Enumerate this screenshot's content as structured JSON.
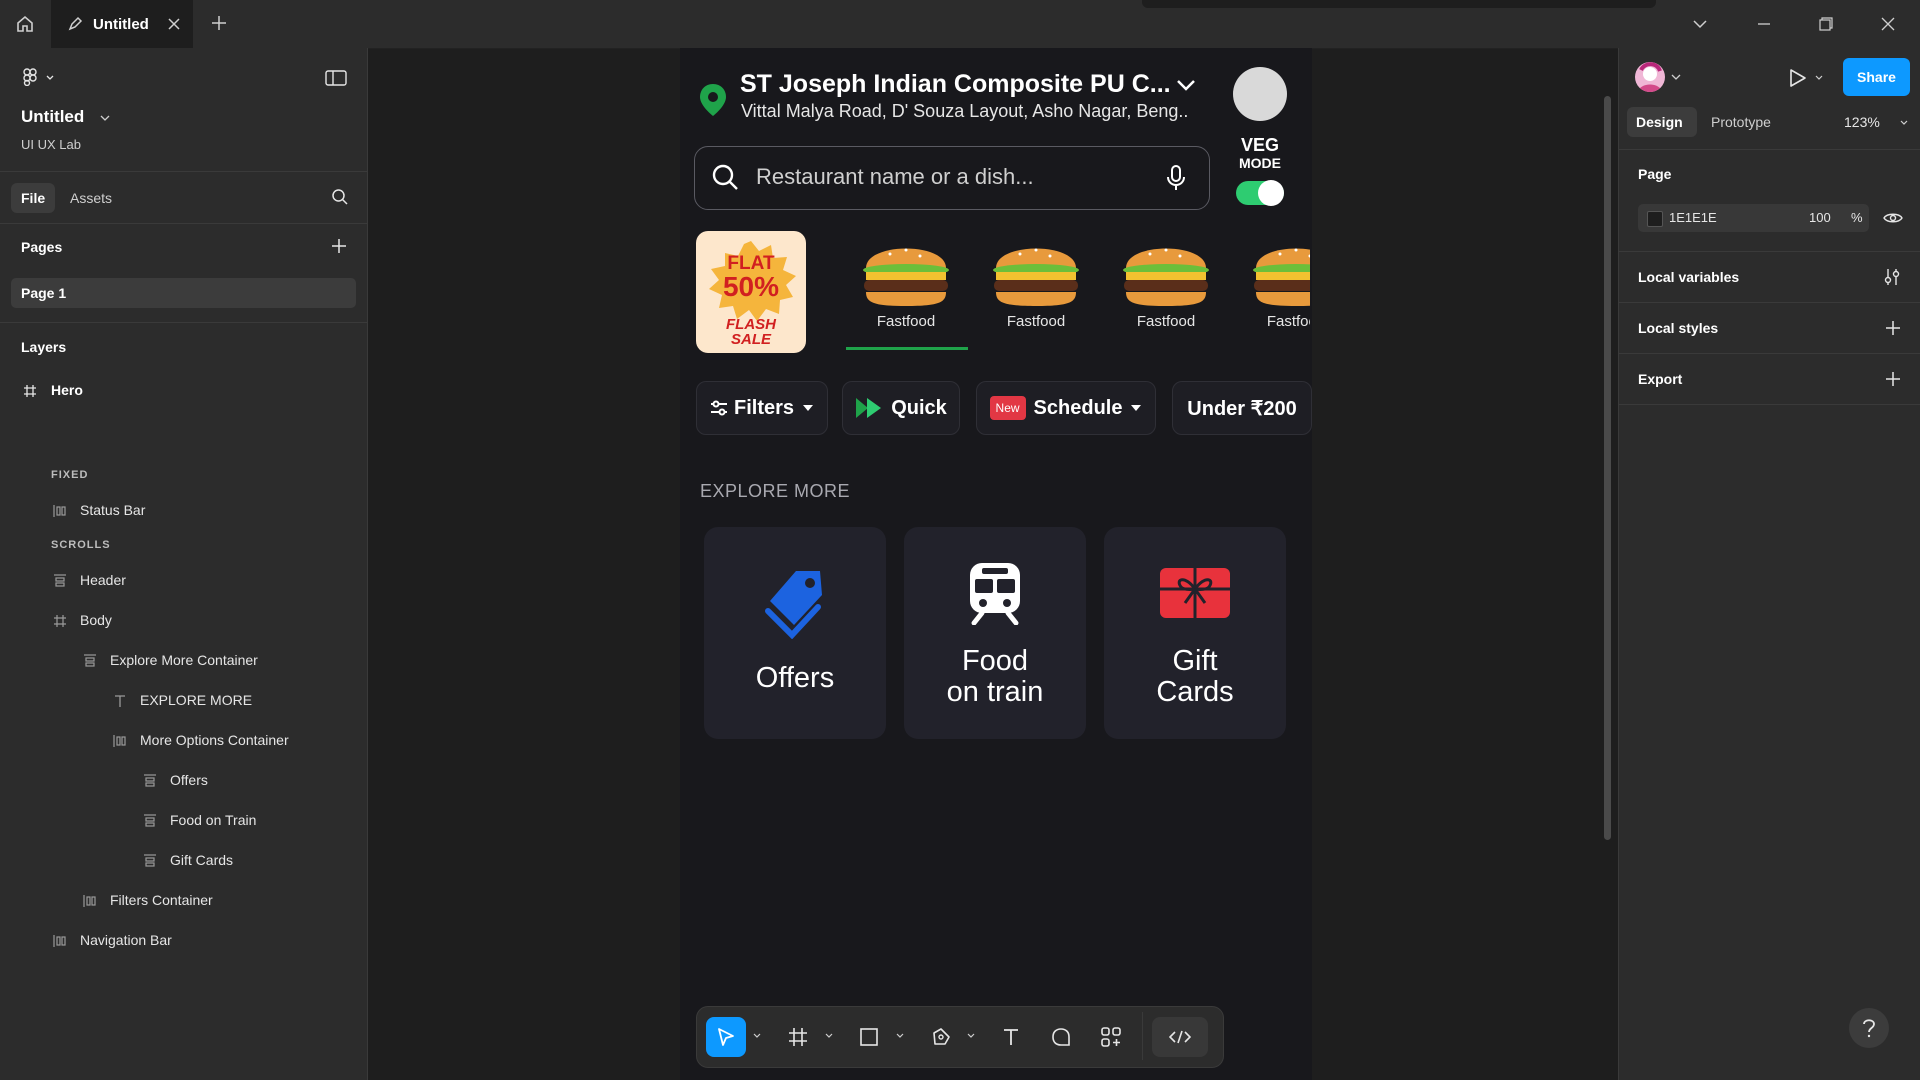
{
  "topbar": {
    "tab_title": "Untitled"
  },
  "left_panel": {
    "file_name": "Untitled",
    "team": "UI UX Lab",
    "tabs": [
      "File",
      "Assets"
    ],
    "pages_title": "Pages",
    "current_page": "Page 1",
    "layers_title": "Layers",
    "layers": [
      {
        "label": "Hero"
      },
      {
        "label": "FIXED"
      },
      {
        "label": "Status Bar"
      },
      {
        "label": "SCROLLS"
      },
      {
        "label": "Header"
      },
      {
        "label": "Body"
      },
      {
        "label": "Explore More Container"
      },
      {
        "label": "EXPLORE MORE"
      },
      {
        "label": "More Options Container"
      },
      {
        "label": "Offers"
      },
      {
        "label": "Food on Train"
      },
      {
        "label": "Gift Cards"
      },
      {
        "label": "Filters Container"
      },
      {
        "label": "Navigation Bar"
      }
    ]
  },
  "right_panel": {
    "tabs": [
      "Design",
      "Prototype"
    ],
    "zoom": "123%",
    "share_label": "Share",
    "page_title": "Page",
    "page_color": "1E1E1E",
    "page_opacity": "100",
    "opacity_unit": "%",
    "local_variables": "Local variables",
    "local_styles": "Local styles",
    "export": "Export"
  },
  "app": {
    "location_title": "ST Joseph Indian Composite PU C...",
    "location_address": "Vittal Malya Road, D' Souza Layout, Asho Nagar, Beng..",
    "veg_mode_line1": "VEG",
    "veg_mode_line2": "MODE",
    "search_placeholder": "Restaurant name or a dish...",
    "promo_line1": "FLAT",
    "promo_line2": "50%",
    "promo_line3": "FLASH",
    "promo_line4": "SALE",
    "categories": [
      "Fastfood",
      "Fastfood",
      "Fastfood",
      "Fastfood"
    ],
    "filters": {
      "filters": "Filters",
      "quick": "Quick",
      "new_badge": "New",
      "schedule": "Schedule",
      "under": "Under ₹200"
    },
    "explore_title": "EXPLORE MORE",
    "cards": [
      {
        "line1": "Offers",
        "line2": ""
      },
      {
        "line1": "Food",
        "line2": "on train"
      },
      {
        "line1": "Gift",
        "line2": "Cards"
      }
    ]
  },
  "colors": {
    "accent": "#0d99ff",
    "veg_green": "#2ecc71",
    "location_green": "#1fa34a",
    "offers_blue": "#1c63e0",
    "gift_red": "#e8323c",
    "new_badge": "#e23744"
  }
}
